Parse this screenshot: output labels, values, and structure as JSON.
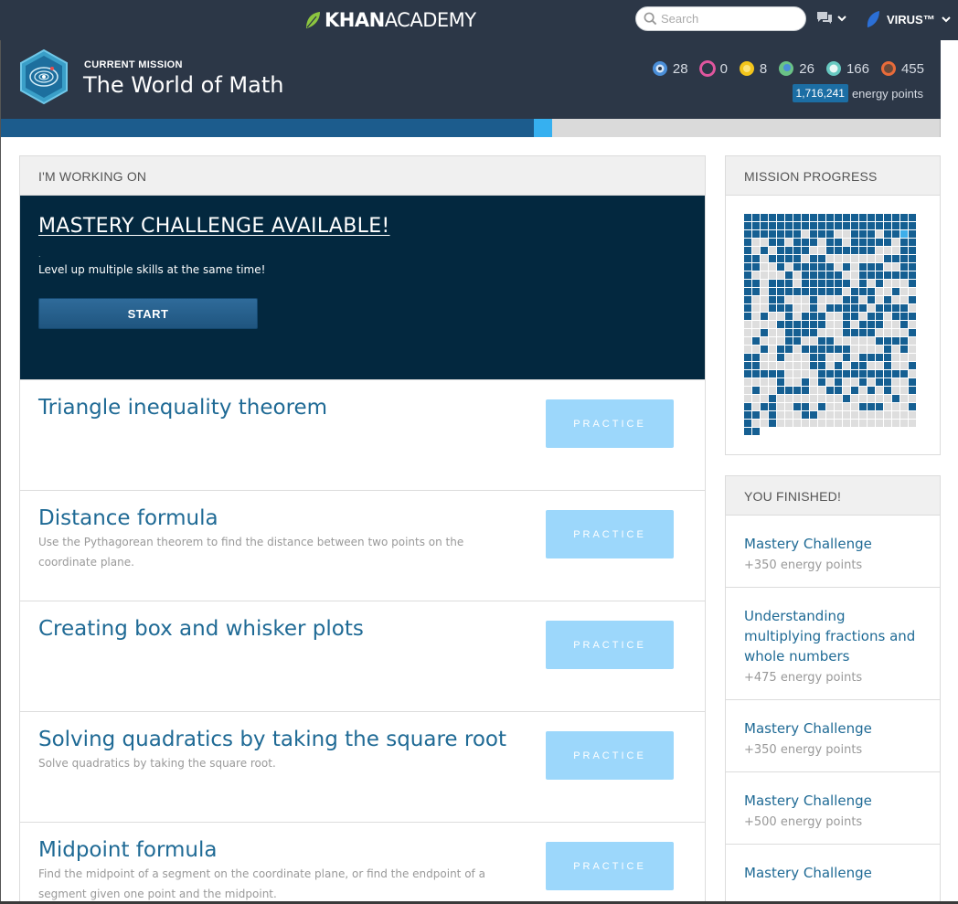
{
  "nav": {
    "logo_bold": "KHAN",
    "logo_regular": "ACADEMY",
    "search_placeholder": "Search",
    "username": "VIRUS™"
  },
  "mission": {
    "label": "CURRENT MISSION",
    "title": "The World of Math",
    "badges": [
      {
        "icon": "black-hole-badge-icon",
        "count": "28",
        "color": "#4a8ed8"
      },
      {
        "icon": "sun-badge-icon",
        "count": "0",
        "color": "#e0569e"
      },
      {
        "icon": "earth-badge-icon",
        "count": "8",
        "color": "#f3c51b"
      },
      {
        "icon": "moon-badge-icon",
        "count": "26",
        "color": "#6ac286"
      },
      {
        "icon": "challenge-badge-icon",
        "count": "166",
        "color": "#67c8c0"
      },
      {
        "icon": "meteorite-badge-icon",
        "count": "455",
        "color": "#e86b3a"
      }
    ],
    "energy_points": "1,716,241",
    "energy_label": "energy points",
    "progress_fraction": 0.567
  },
  "working_on": {
    "heading": "I'M WORKING ON",
    "mastery_title": "MASTERY CHALLENGE AVAILABLE!",
    "mastery_dot": ".",
    "mastery_text": "Level up multiple skills at the same time!",
    "start_label": "START",
    "practice_label": "PRACTICE",
    "skills": [
      {
        "title": "Triangle inequality theorem",
        "desc": ""
      },
      {
        "title": "Distance formula",
        "desc": "Use the Pythagorean theorem to find the distance between two points on the coordinate plane."
      },
      {
        "title": "Creating box and whisker plots",
        "desc": ""
      },
      {
        "title": "Solving quadratics by taking the square root",
        "desc": "Solve quadratics by taking the square root."
      },
      {
        "title": "Midpoint formula",
        "desc": "Find the midpoint of a segment on the coordinate plane, or find the endpoint of a segment given one point and the midpoint."
      }
    ]
  },
  "mission_progress": {
    "heading": "MISSION PROGRESS"
  },
  "finished": {
    "heading": "YOU FINISHED!",
    "items": [
      {
        "title": "Mastery Challenge",
        "points": "+350 energy points"
      },
      {
        "title": "Understanding multiplying fractions and whole numbers",
        "points": "+475 energy points"
      },
      {
        "title": "Mastery Challenge",
        "points": "+350 energy points"
      },
      {
        "title": "Mastery Challenge",
        "points": "+500 energy points"
      },
      {
        "title": "Mastery Challenge",
        "points": ""
      }
    ]
  }
}
